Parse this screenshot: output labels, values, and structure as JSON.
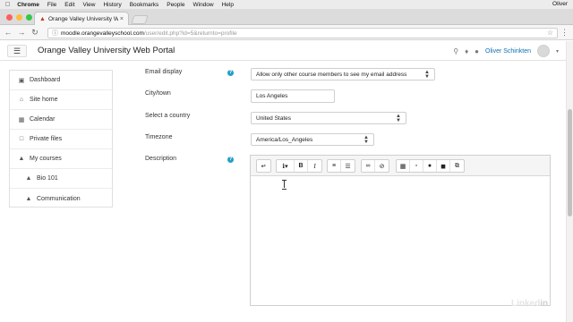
{
  "menubar": {
    "app": "Chrome",
    "items": [
      "File",
      "Edit",
      "View",
      "History",
      "Bookmarks",
      "People",
      "Window",
      "Help"
    ],
    "user": "Oliver"
  },
  "browser": {
    "tab_title": "Orange Valley University Web",
    "url_host": "moodle.orangevalleyschool.com",
    "url_path": "/user/edit.php?id=5&returnto=profile"
  },
  "navbar": {
    "site_name": "Orange Valley University Web Portal",
    "user_name": "Oliver Schinkten"
  },
  "sidebar": {
    "items": [
      {
        "label": "Dashboard",
        "icon": "dashboard-icon"
      },
      {
        "label": "Site home",
        "icon": "home-icon"
      },
      {
        "label": "Calendar",
        "icon": "calendar-icon"
      },
      {
        "label": "Private files",
        "icon": "file-icon"
      },
      {
        "label": "My courses",
        "icon": "graduation-cap-icon"
      },
      {
        "label": "Bio 101",
        "icon": "graduation-cap-icon"
      },
      {
        "label": "Communication",
        "icon": "graduation-cap-icon"
      }
    ]
  },
  "form": {
    "email_display": {
      "label": "Email display",
      "value": "Allow only other course members to see my email address"
    },
    "city": {
      "label": "City/town",
      "value": "Los Angeles"
    },
    "country": {
      "label": "Select a country",
      "value": "United States"
    },
    "timezone": {
      "label": "Timezone",
      "value": "America/Los_Angeles"
    },
    "description": {
      "label": "Description"
    }
  },
  "watermark": {
    "text_a": "Linked",
    "text_b": "in"
  },
  "colors": {
    "link": "#0f6fb3",
    "help": "#23a0c9"
  }
}
